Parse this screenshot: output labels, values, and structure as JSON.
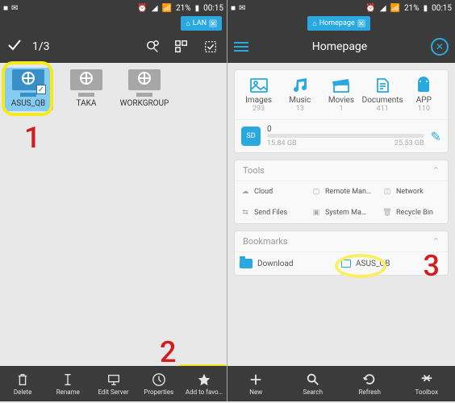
{
  "status": {
    "battery": "21%",
    "time": "00:15"
  },
  "left": {
    "crumb": "LAN",
    "selection": "1/3",
    "items": [
      {
        "name": "ASUS_QB",
        "selected": true
      },
      {
        "name": "TAKA",
        "selected": false
      },
      {
        "name": "WORKGROUP",
        "selected": false
      }
    ],
    "toolbar": [
      "Delete",
      "Rename",
      "Edit Server",
      "Properties",
      "Add to favo…"
    ]
  },
  "right": {
    "crumb": "Homepage",
    "title": "Homepage",
    "cats": [
      {
        "label": "Images",
        "count": "293"
      },
      {
        "label": "Music",
        "count": "13"
      },
      {
        "label": "Movies",
        "count": "1"
      },
      {
        "label": "Documents",
        "count": "411"
      },
      {
        "label": "APP",
        "count": "110"
      }
    ],
    "sd": {
      "label": "SD",
      "count": "0",
      "used": "15.84 GB",
      "total": "25.53 GB"
    },
    "tools_hdr": "Tools",
    "tools": [
      "Cloud",
      "Remote Man…",
      "Network",
      "Send Files",
      "System Ma…",
      "Recycle Bin"
    ],
    "bookmarks_hdr": "Bookmarks",
    "bookmarks": [
      "Download",
      "ASUS_QB"
    ],
    "toolbar": [
      "New",
      "Search",
      "Refresh",
      "Toolbox"
    ]
  },
  "anno": {
    "n1": "1",
    "n2": "2",
    "n3": "3"
  }
}
